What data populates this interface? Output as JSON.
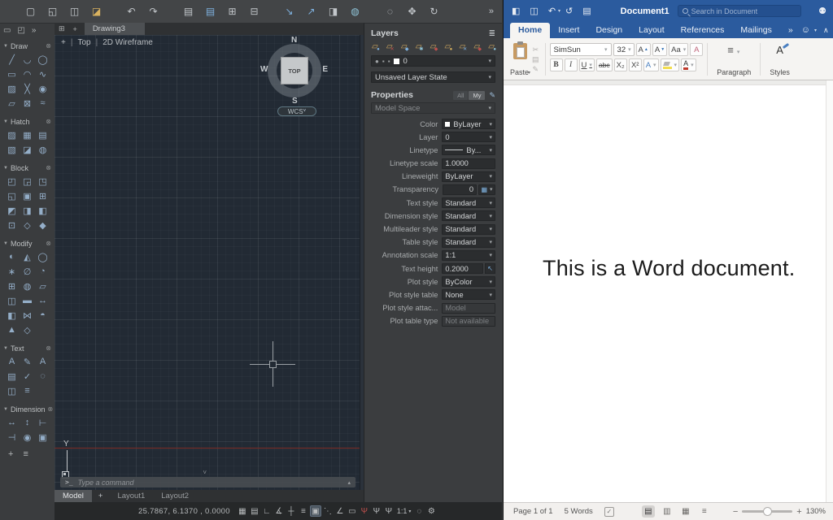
{
  "autocad": {
    "toolbar": [
      {
        "name": "new-file-icon",
        "glyph": "▢"
      },
      {
        "name": "open-file-icon",
        "glyph": "◱"
      },
      {
        "name": "save-icon",
        "glyph": "◫"
      },
      {
        "name": "save-as-icon",
        "glyph": "◪",
        "color": "#d9b25f"
      },
      {
        "spacer": true
      },
      {
        "name": "undo-icon",
        "glyph": "↶"
      },
      {
        "name": "redo-icon",
        "glyph": "↷"
      },
      {
        "spacer": true
      },
      {
        "name": "print-icon",
        "glyph": "▤"
      },
      {
        "name": "plot-icon",
        "glyph": "▤",
        "color": "#7fb2e0"
      },
      {
        "name": "copy-icon",
        "glyph": "⊞"
      },
      {
        "name": "paste-icon",
        "glyph": "⊟"
      },
      {
        "spacer": true
      },
      {
        "name": "import-icon",
        "glyph": "↘",
        "color": "#7fb2e0"
      },
      {
        "name": "export-icon",
        "glyph": "↗",
        "color": "#7fb2e0"
      },
      {
        "name": "package-icon",
        "glyph": "◨"
      },
      {
        "name": "etransmit-icon",
        "glyph": "◍",
        "color": "#8fc4d8"
      },
      {
        "spacer": true
      },
      {
        "name": "zoom-tool-icon",
        "glyph": "◌"
      },
      {
        "name": "pan-icon",
        "glyph": "✥"
      },
      {
        "name": "orbit-icon",
        "glyph": "↻"
      }
    ],
    "toolbar_overflow": "»",
    "sidebar": {
      "window_icons": [
        {
          "name": "viewport-icon",
          "glyph": "▭"
        },
        {
          "name": "views-icon",
          "glyph": "◰"
        },
        {
          "name": "sidebar-overflow-icon",
          "glyph": "»"
        }
      ],
      "caret": "▼",
      "sections": [
        {
          "label": "Draw",
          "icons": [
            {
              "name": "line-icon",
              "glyph": "╱"
            },
            {
              "name": "polyline-icon",
              "glyph": "◡"
            },
            {
              "name": "circle-icon",
              "glyph": "◯"
            },
            {
              "name": "rectangle-icon",
              "glyph": "▭"
            },
            {
              "name": "arc-icon",
              "glyph": "◠"
            },
            {
              "name": "spline-icon",
              "glyph": "∿"
            },
            {
              "name": "hatch-lines-icon",
              "glyph": "▨"
            },
            {
              "name": "point-icon",
              "glyph": "╳"
            },
            {
              "name": "ellipse-icon",
              "glyph": "◉"
            },
            {
              "name": "region-icon",
              "glyph": "▱"
            },
            {
              "name": "boundary-icon",
              "glyph": "⊠"
            },
            {
              "name": "revision-cloud-icon",
              "glyph": "≈"
            }
          ]
        },
        {
          "label": "Hatch",
          "icons": [
            {
              "name": "hatch-icon",
              "glyph": "▨"
            },
            {
              "name": "hatch-edit-icon",
              "glyph": "▦"
            },
            {
              "name": "hatch-solid-icon",
              "glyph": "▤"
            },
            {
              "name": "hatch-gradient-icon",
              "glyph": "▧"
            },
            {
              "name": "hatch-boundary-icon",
              "glyph": "◪"
            },
            {
              "name": "hatch-image-icon",
              "glyph": "◍"
            }
          ]
        },
        {
          "label": "Block",
          "icons": [
            {
              "name": "insert-block-icon",
              "glyph": "◰"
            },
            {
              "name": "create-block-icon",
              "glyph": "◲"
            },
            {
              "name": "edit-block-icon",
              "glyph": "◳"
            },
            {
              "name": "attribute-icon",
              "glyph": "◱"
            },
            {
              "name": "define-attribute-icon",
              "glyph": "▣"
            },
            {
              "name": "block-editor-icon",
              "glyph": "⊞"
            },
            {
              "name": "sync-attribute-icon",
              "glyph": "◩"
            },
            {
              "name": "manage-attribute-icon",
              "glyph": "◨"
            },
            {
              "name": "block-palette-icon",
              "glyph": "◧"
            },
            {
              "name": "set-base-point-icon",
              "glyph": "⊡"
            },
            {
              "name": "wblock-icon",
              "glyph": "◇"
            },
            {
              "name": "purge-block-icon",
              "glyph": "◆"
            }
          ]
        },
        {
          "label": "Modify",
          "icons": [
            {
              "name": "move-icon",
              "glyph": "◐"
            },
            {
              "name": "mirror-icon",
              "glyph": "◭"
            },
            {
              "name": "rotate-icon",
              "glyph": "◯"
            },
            {
              "name": "explode-icon",
              "glyph": "∗"
            },
            {
              "name": "trim-icon",
              "glyph": "∅"
            },
            {
              "name": "fillet-icon",
              "glyph": "◔"
            },
            {
              "name": "array-icon",
              "glyph": "⊞"
            },
            {
              "name": "offset-icon",
              "glyph": "◍"
            },
            {
              "name": "scale-icon",
              "glyph": "▱"
            },
            {
              "name": "stretch-icon",
              "glyph": "◫"
            },
            {
              "name": "lengthen-icon",
              "glyph": "▬"
            },
            {
              "name": "extend-icon",
              "glyph": "↔"
            },
            {
              "name": "break-icon",
              "glyph": "◧"
            },
            {
              "name": "join-icon",
              "glyph": "⋈"
            },
            {
              "name": "chamfer-icon",
              "glyph": "◓"
            },
            {
              "name": "align-icon",
              "glyph": "▲"
            },
            {
              "name": "erase-icon",
              "glyph": "◇"
            }
          ]
        },
        {
          "label": "Text",
          "icons": [
            {
              "name": "mtext-icon",
              "glyph": "A"
            },
            {
              "name": "edit-text-icon",
              "glyph": "✎"
            },
            {
              "name": "single-text-icon",
              "glyph": "A"
            },
            {
              "name": "text-style-icon",
              "glyph": "▤"
            },
            {
              "name": "spell-check-icon",
              "glyph": "✓"
            },
            {
              "name": "find-text-icon",
              "glyph": "◌"
            },
            {
              "name": "columns-icon",
              "glyph": "◫"
            },
            {
              "name": "justify-icon",
              "glyph": "≡"
            }
          ]
        },
        {
          "label": "Dimension",
          "icons": [
            {
              "name": "linear-dimension-icon",
              "glyph": "↔"
            },
            {
              "name": "aligned-dimension-icon",
              "glyph": "↕"
            },
            {
              "name": "angular-dimension-icon",
              "glyph": "⊢"
            },
            {
              "name": "radius-dimension-icon",
              "glyph": "⊣"
            },
            {
              "name": "center-mark-icon",
              "glyph": "◉"
            },
            {
              "name": "dimension-style-icon",
              "glyph": "▣"
            }
          ]
        }
      ],
      "section_gear": "⊗",
      "footer": [
        {
          "name": "add-palette-icon",
          "glyph": "+"
        },
        {
          "name": "palette-menu-icon",
          "glyph": "≡"
        }
      ]
    },
    "doc_tabs": {
      "grid_icon": "⊞",
      "new_tab": "+",
      "active_tab": "Drawing3"
    },
    "viewport": {
      "controls": "+",
      "view_label": "Top",
      "style_label": "2D Wireframe",
      "separator": "|"
    },
    "viewcube": {
      "n": "N",
      "s": "S",
      "e": "E",
      "w": "W",
      "face": "TOP",
      "wcs": "WCS"
    },
    "command": {
      "prompt": ">_",
      "placeholder": "Type a command",
      "chevron": "˅",
      "expand": "▴"
    },
    "layout_tabs": {
      "model": "Model",
      "add": "+",
      "tabs": [
        "Layout1",
        "Layout2"
      ]
    },
    "statusbar": {
      "coords": "25.7867, 6.1370 , 0.0000",
      "icons": [
        {
          "name": "grid-icon",
          "glyph": "▦"
        },
        {
          "name": "snap-icon",
          "glyph": "▤"
        },
        {
          "name": "ortho-icon",
          "glyph": "∟"
        },
        {
          "name": "polar-tracking-icon",
          "glyph": "∡"
        },
        {
          "name": "osnap-icon",
          "glyph": "┼"
        },
        {
          "name": "lineweight-icon",
          "glyph": "≡"
        },
        {
          "name": "transparency-icon",
          "glyph": "▣",
          "active": true
        },
        {
          "name": "selection-cycling-icon",
          "glyph": "⋱"
        },
        {
          "name": "dynamic-input-icon",
          "glyph": "∠"
        },
        {
          "name": "selection-box-icon",
          "glyph": "▭"
        },
        {
          "name": "annotation-visibility-icon",
          "glyph": "Ψ",
          "red": true
        },
        {
          "name": "autoscale-icon",
          "glyph": "Ψ"
        },
        {
          "name": "annotation-scale-list-icon",
          "glyph": "Ψ"
        }
      ],
      "scale": "1:1",
      "icons_right": [
        {
          "name": "annotation-monitor-icon",
          "glyph": "◌"
        },
        {
          "name": "settings-gear-icon",
          "glyph": "⚙"
        }
      ]
    },
    "layers_panel": {
      "title": "Layers",
      "panel_icon": "≣",
      "tools": [
        {
          "name": "layer-properties-icon"
        },
        {
          "name": "layer-off-icon"
        },
        {
          "name": "layer-isolate-icon"
        },
        {
          "name": "layer-freeze-icon"
        },
        {
          "name": "layer-lock-icon"
        },
        {
          "name": "layer-current-icon"
        },
        {
          "name": "layer-match-icon"
        },
        {
          "name": "layer-unlock-icon"
        },
        {
          "name": "layer-walk-icon"
        }
      ],
      "current_layer": "0",
      "layer_state": "Unsaved Layer State"
    },
    "properties_panel": {
      "title": "Properties",
      "filter_all": "All",
      "filter_my": "My",
      "edit_icon": "✎",
      "space": "Model Space",
      "rows": [
        {
          "label": "Color",
          "value": "ByLayer",
          "type": "dd",
          "swatch": true
        },
        {
          "label": "Layer",
          "value": "0",
          "type": "dd"
        },
        {
          "label": "Linetype",
          "value": "By...",
          "type": "dd",
          "line": true
        },
        {
          "label": "Linetype scale",
          "value": "1.0000",
          "type": "input"
        },
        {
          "label": "Lineweight",
          "value": "ByLayer",
          "type": "dd"
        },
        {
          "label": "Transparency",
          "value": "0",
          "type": "transp"
        },
        {
          "label": "Text style",
          "value": "Standard",
          "type": "dd"
        },
        {
          "label": "Dimension style",
          "value": "Standard",
          "type": "dd"
        },
        {
          "label": "Multileader style",
          "value": "Standard",
          "type": "dd"
        },
        {
          "label": "Table style",
          "value": "Standard",
          "type": "dd"
        },
        {
          "label": "Annotation scale",
          "value": "1:1",
          "type": "dd"
        },
        {
          "label": "Text height",
          "value": "0.2000",
          "type": "pick"
        },
        {
          "label": "Plot style",
          "value": "ByColor",
          "type": "dd"
        },
        {
          "label": "Plot style table",
          "value": "None",
          "type": "dd"
        },
        {
          "label": "Plot style attac...",
          "value": "Model",
          "type": "dis"
        },
        {
          "label": "Plot table type",
          "value": "Not available",
          "type": "dis"
        }
      ]
    }
  },
  "word": {
    "titlebar": {
      "title": "Document1",
      "search_placeholder": "Search in Document",
      "icons": [
        {
          "name": "sidebar-toggle-icon",
          "glyph": "◧"
        },
        {
          "name": "save-icon",
          "glyph": "◫"
        },
        {
          "name": "undo-icon",
          "glyph": "↶",
          "dd": true
        },
        {
          "name": "redo-icon",
          "glyph": "↺"
        },
        {
          "name": "print-icon",
          "glyph": "▤"
        }
      ]
    },
    "tabs": [
      {
        "label": "Home",
        "active": true
      },
      {
        "label": "Insert"
      },
      {
        "label": "Design"
      },
      {
        "label": "Layout"
      },
      {
        "label": "References"
      },
      {
        "label": "Mailings"
      },
      {
        "label": "»"
      }
    ],
    "tab_extras": {
      "smiley": "☺",
      "collapse": "∧"
    },
    "home": {
      "paste_label": "Paste",
      "font_name": "SimSun",
      "font_size": "32",
      "bold": "B",
      "italic": "I",
      "underline": "U",
      "strike": "abc",
      "subscript": "X₂",
      "superscript": "X²",
      "grow_font": "A",
      "shrink_font": "A",
      "change_case": "Aa",
      "clear_format": "A",
      "text_effects": "A",
      "font_color": "A",
      "paragraph_label": "Paragraph",
      "styles_label": "Styles",
      "styles_glyph": "A"
    },
    "body_text": "This is a Word document.",
    "statusbar": {
      "page": "Page 1 of 1",
      "words": "5 Words",
      "spell_glyph": "✓",
      "views": [
        {
          "name": "print-layout-view-icon",
          "glyph": "▤",
          "active": true
        },
        {
          "name": "web-layout-view-icon",
          "glyph": "▥"
        },
        {
          "name": "outline-view-icon",
          "glyph": "▦"
        },
        {
          "name": "focus-view-icon",
          "glyph": "≡"
        }
      ],
      "zoom_minus": "−",
      "zoom_plus": "+",
      "zoom": "130%"
    }
  },
  "colors": {
    "canvas_bg": "#222a34",
    "panel_bg": "#3b3d3f",
    "word_blue": "#2b5b9e",
    "layer_icon_gold": "#cfa75f",
    "accent_blue": "#7fb2e0",
    "axis_red": "#7e2c26",
    "highlight_yellow": "#f2dd4e",
    "font_color_red": "#c0392b"
  }
}
